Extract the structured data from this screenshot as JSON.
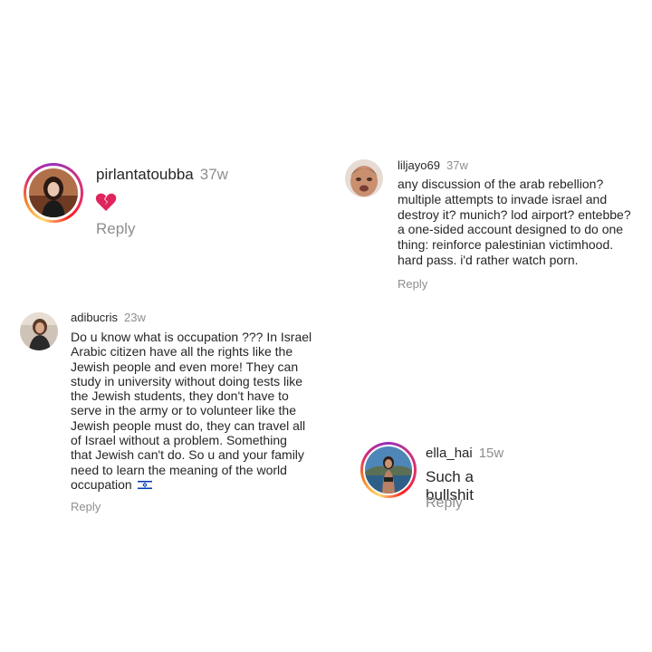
{
  "comments": [
    {
      "username": "pirlantatoubba",
      "time": "37w",
      "emoji": "broken-heart",
      "reply_label": "Reply",
      "has_story_ring": true
    },
    {
      "username": "liljayo69",
      "time": "37w",
      "text": "any discussion of the arab rebellion?\nmultiple attempts to invade israel and\ndestroy it? munich? lod airport? entebbe?\na one-sided account designed to do one\nthing: reinforce palestinian victimhood.\nhard pass.  i'd rather watch porn.",
      "reply_label": "Reply",
      "has_story_ring": false
    },
    {
      "username": "adibucris",
      "time": "23w",
      "text": "Do u know what is occupation ??? In Israel\nArabic citizen have all the rights like the\nJewish people and even more! They can\nstudy in university without doing tests like\nthe Jewish students, they don't have to\nserve in the army or to volunteer like the\nJewish people must do, they can travel all\nof Israel without a problem. Something\nthat Jewish can't do. So u and your family\nneed to learn the meaning of the world\noccupation",
      "trailing_emoji": "israel-flag",
      "reply_label": "Reply",
      "has_story_ring": false
    },
    {
      "username": "ella_hai",
      "time": "15w",
      "text": "Such a bullshit",
      "reply_label": "Reply",
      "has_story_ring": true
    }
  ],
  "colors": {
    "text": "#262626",
    "secondary": "#8e8e8e",
    "broken_heart": "#e0245e",
    "flag_blue": "#0038b8"
  }
}
